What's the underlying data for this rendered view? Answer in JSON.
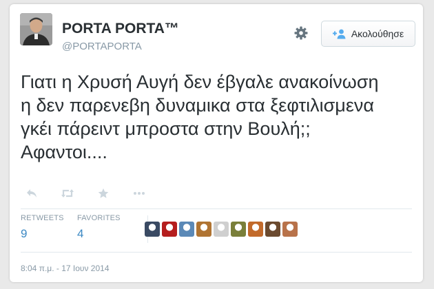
{
  "profile": {
    "display_name": "PORTA PORTA™",
    "handle": "@PORTAPORTA"
  },
  "follow_button": {
    "label": "Ακολούθησε"
  },
  "tweet": {
    "lines": [
      "Γιατι η Χρυσή Αυγή δεν έβγαλε ανακοίνωση",
      "η δεν παρενεβη δυναμικα στα ξεφτιλισμενα",
      "γκέι πάρειντ μπροστα στην Βουλή;;",
      "Αφαντοι...."
    ]
  },
  "actions": {
    "icons": [
      "reply-icon",
      "retweet-icon",
      "favorite-icon",
      "more-icon"
    ],
    "icon_color": "#ccd6dd"
  },
  "stats": {
    "retweets_label": "RETWEETS",
    "retweets_count": "9",
    "favorites_label": "FAVORITES",
    "favorites_count": "4"
  },
  "favoriters": {
    "count_shown": 9,
    "colors": [
      "#3a4a63",
      "#b51e1e",
      "#5b89b7",
      "#b07432",
      "#cfcfcf",
      "#7a7f3a",
      "#c26a2b",
      "#6b4a2f",
      "#b8724a"
    ]
  },
  "timestamp": "8:04 π.μ. - 17 Ιουν 2014",
  "colors": {
    "link": "#3b88c3",
    "muted": "#8899a6",
    "text": "#292f33",
    "border": "#e1e8ed",
    "follow_icon": "#55acee"
  }
}
